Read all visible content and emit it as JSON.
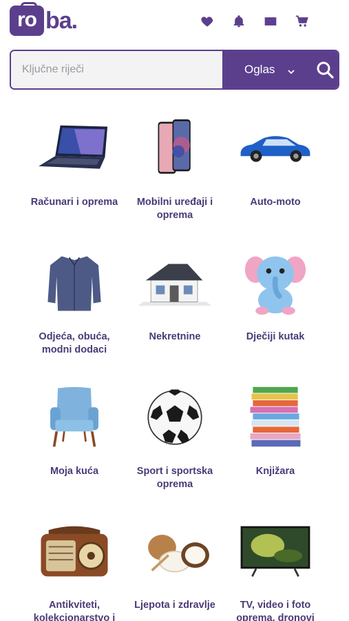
{
  "header": {
    "logo_box_text": "ro",
    "logo_text": "ba.",
    "icons": [
      "heart-icon",
      "bell-icon",
      "mail-icon",
      "cart-icon"
    ]
  },
  "search": {
    "placeholder": "Ključne riječi",
    "select_value": "Oglas"
  },
  "categories": [
    {
      "label": "Računari i oprema",
      "icon": "laptop"
    },
    {
      "label": "Mobilni uređaji i oprema",
      "icon": "phone"
    },
    {
      "label": "Auto-moto",
      "icon": "car"
    },
    {
      "label": "Odjeća, obuća, modni dodaci",
      "icon": "shirt"
    },
    {
      "label": "Nekretnine",
      "icon": "house"
    },
    {
      "label": "Dječiji kutak",
      "icon": "toy-elephant"
    },
    {
      "label": "Moja kuća",
      "icon": "armchair"
    },
    {
      "label": "Sport i sportska oprema",
      "icon": "soccer-ball"
    },
    {
      "label": "Knjižara",
      "icon": "books"
    },
    {
      "label": "Antikviteti, kolekcionarstvo i",
      "icon": "radio"
    },
    {
      "label": "Ljepota i zdravlje",
      "icon": "coconut"
    },
    {
      "label": "TV, video i foto oprema, dronovi",
      "icon": "tv"
    }
  ],
  "colors": {
    "brand": "#5b3f8c",
    "label": "#4a3a78",
    "search_bg": "#f3f3f4"
  }
}
